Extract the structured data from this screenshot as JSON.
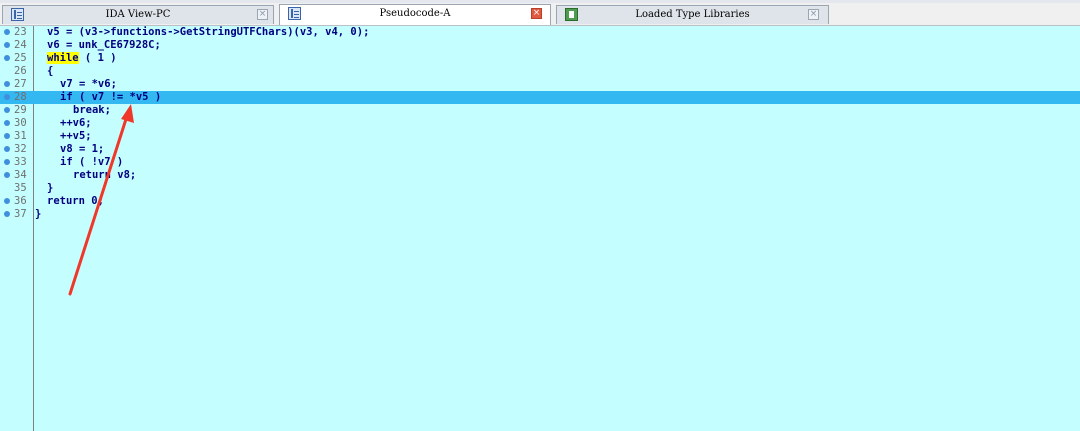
{
  "tabs": [
    {
      "label": "IDA View-PC",
      "icon": "code-view-icon",
      "close_style": "grey"
    },
    {
      "label": "Pseudocode-A",
      "icon": "code-view-icon",
      "close_style": "red",
      "active": true
    },
    {
      "label": "Loaded Type Libraries",
      "icon": "library-icon",
      "close_style": "grey"
    }
  ],
  "code": {
    "lines": [
      {
        "num": "23",
        "text": "v5 = (v3->functions->GetStringUTFChars)(v3, v4, 0);"
      },
      {
        "num": "24",
        "text": "v6 = unk_CE67928C;"
      },
      {
        "num": "25",
        "text": "while ( 1 )"
      },
      {
        "num": "26",
        "text": "{"
      },
      {
        "num": "27",
        "text": "v7 = *v6;"
      },
      {
        "num": "28",
        "text": "if ( v7 != *v5 )"
      },
      {
        "num": "29",
        "text": "break;"
      },
      {
        "num": "30",
        "text": "++v6;"
      },
      {
        "num": "31",
        "text": "++v5;"
      },
      {
        "num": "32",
        "text": "v8 = 1;"
      },
      {
        "num": "33",
        "text": "if ( !v7 )"
      },
      {
        "num": "34",
        "text": "return v8;"
      },
      {
        "num": "35",
        "text": "}"
      },
      {
        "num": "36",
        "text": "return 0;"
      },
      {
        "num": "37",
        "text": "}"
      }
    ],
    "highlighted_line": "28"
  },
  "colors": {
    "background": "#c5fefe",
    "highlight": "#34b8f2",
    "arrow": "#f0382a"
  }
}
